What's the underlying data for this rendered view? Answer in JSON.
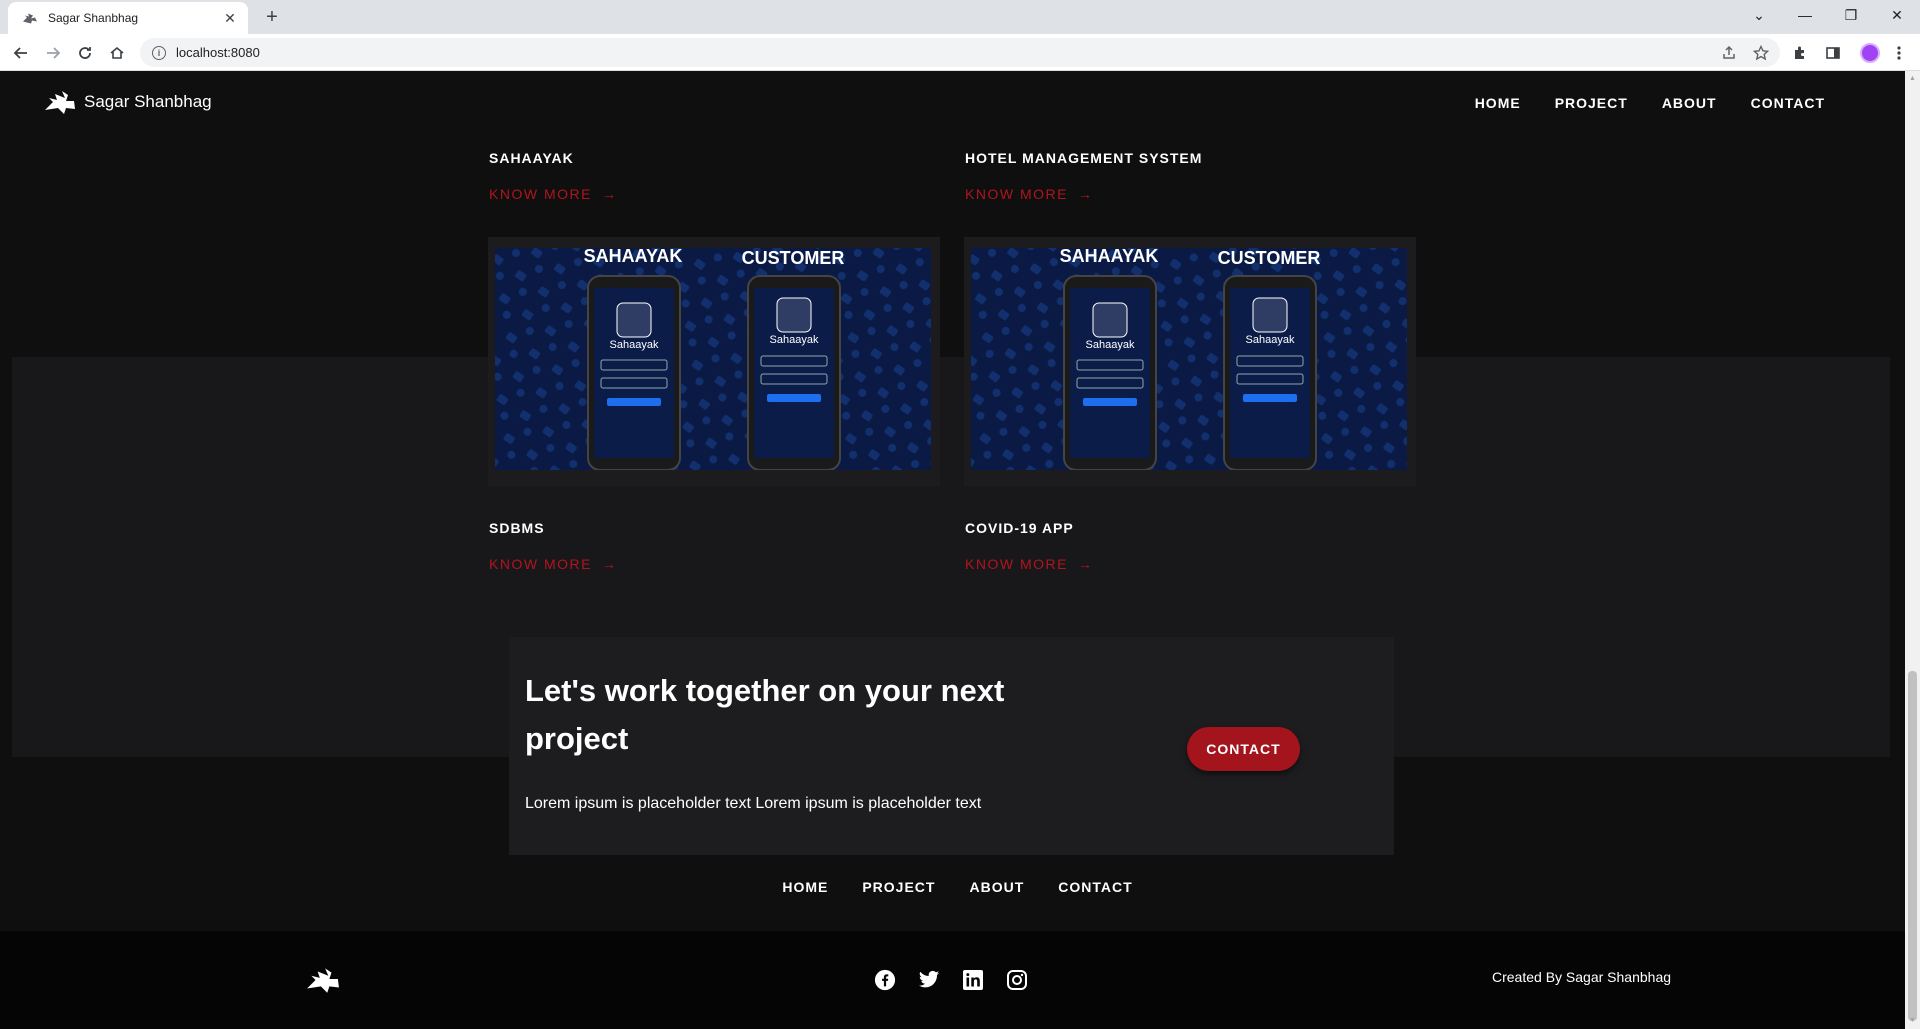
{
  "browser": {
    "tab_title": "Sagar Shanbhag",
    "url": "localhost:8080"
  },
  "site": {
    "brand": "Sagar Shanbhag",
    "nav": [
      "HOME",
      "PROJECT",
      "ABOUT",
      "CONTACT"
    ],
    "projects": [
      {
        "title": "SAHAAYAK",
        "link": "KNOW MORE"
      },
      {
        "title": "HOTEL MANAGEMENT SYSTEM",
        "link": "KNOW MORE"
      },
      {
        "title": "SDBMS",
        "link": "KNOW MORE"
      },
      {
        "title": "COVID-19 APP",
        "link": "KNOW MORE"
      }
    ],
    "card_image": {
      "left_label": "SAHAAYAK",
      "right_label": "CUSTOMER",
      "app_name": "Sahaayak"
    },
    "cta": {
      "heading": "Let's work together on your next project",
      "text": "Lorem ipsum is placeholder text Lorem ipsum is placeholder text",
      "button": "CONTACT"
    },
    "footer": {
      "nav": [
        "HOME",
        "PROJECT",
        "ABOUT",
        "CONTACT"
      ],
      "credit": "Created By Sagar Shanbhag",
      "socials": [
        "facebook-icon",
        "twitter-icon",
        "linkedin-icon",
        "instagram-icon"
      ]
    }
  },
  "colors": {
    "accent": "#a3141d",
    "link": "#b0151e",
    "background": "#0f0f10",
    "band": "#18181a"
  }
}
